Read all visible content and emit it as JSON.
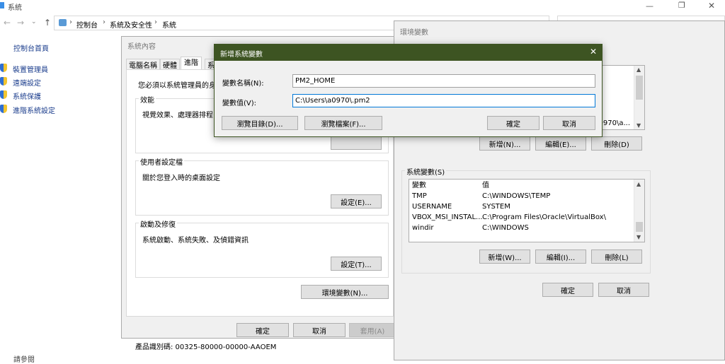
{
  "window": {
    "title": "系統"
  },
  "address": {
    "crumbs": [
      "控制台",
      "系統及安全性",
      "系統"
    ]
  },
  "sidebar": {
    "home": "控制台首頁",
    "items": [
      "裝置管理員",
      "遠端設定",
      "系統保護",
      "進階系統設定"
    ],
    "see_also": "請參閱"
  },
  "product_id": "產品識別碼: 00325-80000-00000-AAOEM",
  "sysprops": {
    "title": "系統內容",
    "tabs": [
      "電腦名稱",
      "硬體",
      "進階",
      "系"
    ],
    "intro": "您必須以系統管理員的身",
    "perf": {
      "title": "效能",
      "desc": "視覺效果、處理器排程"
    },
    "profiles": {
      "title": "使用者設定檔",
      "desc": "關於您登入時的桌面設定",
      "button": "設定(E)..."
    },
    "startup": {
      "title": "啟動及修復",
      "desc": "系統啟動、系統失敗、及偵錯資訊",
      "button": "設定(T)..."
    },
    "env_button": "環境變數(N)...",
    "ok": "確定",
    "cancel": "取消",
    "apply": "套用(A)"
  },
  "envvars": {
    "title": "環境變數",
    "user_partial_value": "0970\\a...",
    "user_buttons": {
      "new": "新增(N)...",
      "edit": "編輯(E)...",
      "delete": "刪除(D)"
    },
    "system_title": "系統變數(S)",
    "columns": {
      "var": "變數",
      "val": "值"
    },
    "rows": [
      {
        "var": "TMP",
        "val": "C:\\WINDOWS\\TEMP"
      },
      {
        "var": "USERNAME",
        "val": "SYSTEM"
      },
      {
        "var": "VBOX_MSI_INSTAL...",
        "val": "C:\\Program Files\\Oracle\\VirtualBox\\"
      },
      {
        "var": "windir",
        "val": "C:\\WINDOWS"
      }
    ],
    "sys_buttons": {
      "new": "新增(W)...",
      "edit": "編輯(I)...",
      "delete": "刪除(L)"
    },
    "ok": "確定",
    "cancel": "取消"
  },
  "newvar": {
    "title": "新增系統變數",
    "name_label": "變數名稱(N):",
    "name_value": "PM2_HOME",
    "value_label": "變數值(V):",
    "value_value": "C:\\Users\\a0970\\.pm2",
    "browse_dir": "瀏覽目錄(D)...",
    "browse_file": "瀏覽檔案(F)...",
    "ok": "確定",
    "cancel": "取消"
  },
  "colors": {
    "titlebar_dark": "#3d5422",
    "accent": "#0078d7"
  }
}
